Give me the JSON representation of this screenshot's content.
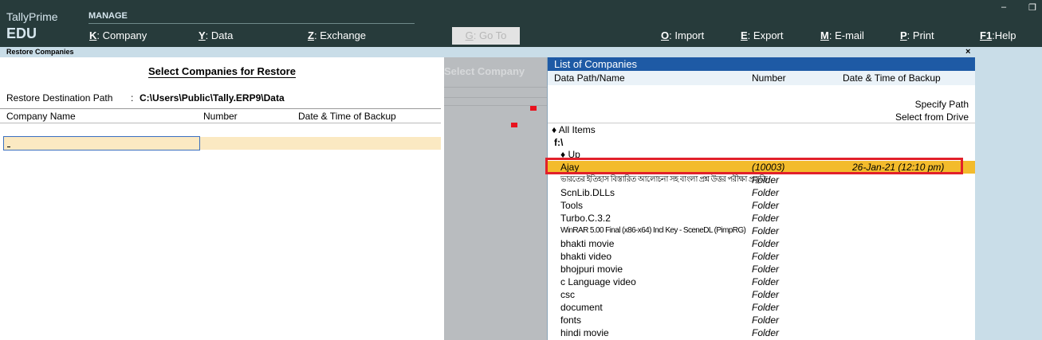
{
  "brand": {
    "name": "TallyPrime",
    "edition": "EDU"
  },
  "manage": {
    "label": "MANAGE",
    "items": [
      {
        "key": "K",
        "sep": ":",
        "label": "Company"
      },
      {
        "key": "Y",
        "sep": ":",
        "label": "Data"
      },
      {
        "key": "Z",
        "sep": ":",
        "label": "Exchange"
      }
    ]
  },
  "goto": {
    "key": "G",
    "sep": ":",
    "label": "Go To"
  },
  "actions": [
    {
      "key": "O",
      "sep": ":",
      "label": "Import"
    },
    {
      "key": "E",
      "sep": ":",
      "label": "Export"
    },
    {
      "key": "M",
      "sep": ":",
      "label": "E-mail"
    },
    {
      "key": "P",
      "sep": ":",
      "label": "Print"
    },
    {
      "key": "F1",
      "sep": ":",
      "label": "Help"
    }
  ],
  "window": {
    "title": "Restore Companies",
    "close": "×",
    "minimize": "–",
    "restore": "❐"
  },
  "restore_form": {
    "heading": "Select Companies for Restore",
    "dest_label": "Restore Destination Path",
    "dest_sep": ":",
    "dest_value": "C:\\Users\\Public\\Tally.ERP9\\Data",
    "columns": [
      "Company Name",
      "Number",
      "Date & Time of Backup"
    ]
  },
  "middle": {
    "heading": "Select Company"
  },
  "list_panel": {
    "title": "List of Companies",
    "columns": [
      "Data Path/Name",
      "Number",
      "Date & Time of Backup"
    ],
    "specify_path": "Specify Path",
    "select_drive": "Select from Drive",
    "all_items": "All Items",
    "drive": "f:\\",
    "up": "Up",
    "rows": [
      {
        "name": "Ajay",
        "number": "(10003)",
        "date": "26-Jan-21 (12:10 pm)",
        "selected": true
      },
      {
        "name": "ভারতের ইতিহাস বিস্তারিত আলোচনা সহ বাংলা প্রশ্ন উত্তর পরীক্ষা প্রস্তুতি",
        "number": "Folder",
        "date": ""
      },
      {
        "name": "ScnLib.DLLs",
        "number": "Folder",
        "date": ""
      },
      {
        "name": "Tools",
        "number": "Folder",
        "date": ""
      },
      {
        "name": "Turbo.C.3.2",
        "number": "Folder",
        "date": ""
      },
      {
        "name": "WinRAR 5.00 Final (x86-x64) Incl Key - SceneDL  (PimpRG)",
        "number": "Folder",
        "date": ""
      },
      {
        "name": "bhakti movie",
        "number": "Folder",
        "date": ""
      },
      {
        "name": "bhakti video",
        "number": "Folder",
        "date": ""
      },
      {
        "name": "bhojpuri movie",
        "number": "Folder",
        "date": ""
      },
      {
        "name": "c Language video",
        "number": "Folder",
        "date": ""
      },
      {
        "name": "csc",
        "number": "Folder",
        "date": ""
      },
      {
        "name": "document",
        "number": "Folder",
        "date": ""
      },
      {
        "name": "fonts",
        "number": "Folder",
        "date": ""
      },
      {
        "name": "hindi movie",
        "number": "Folder",
        "date": ""
      }
    ]
  },
  "colors": {
    "topbar": "#273b3b",
    "titlebar": "#c9dde8",
    "list_header": "#1e5aa5",
    "selected_row": "#f3bb2c",
    "highlight_box": "#e2202a"
  }
}
